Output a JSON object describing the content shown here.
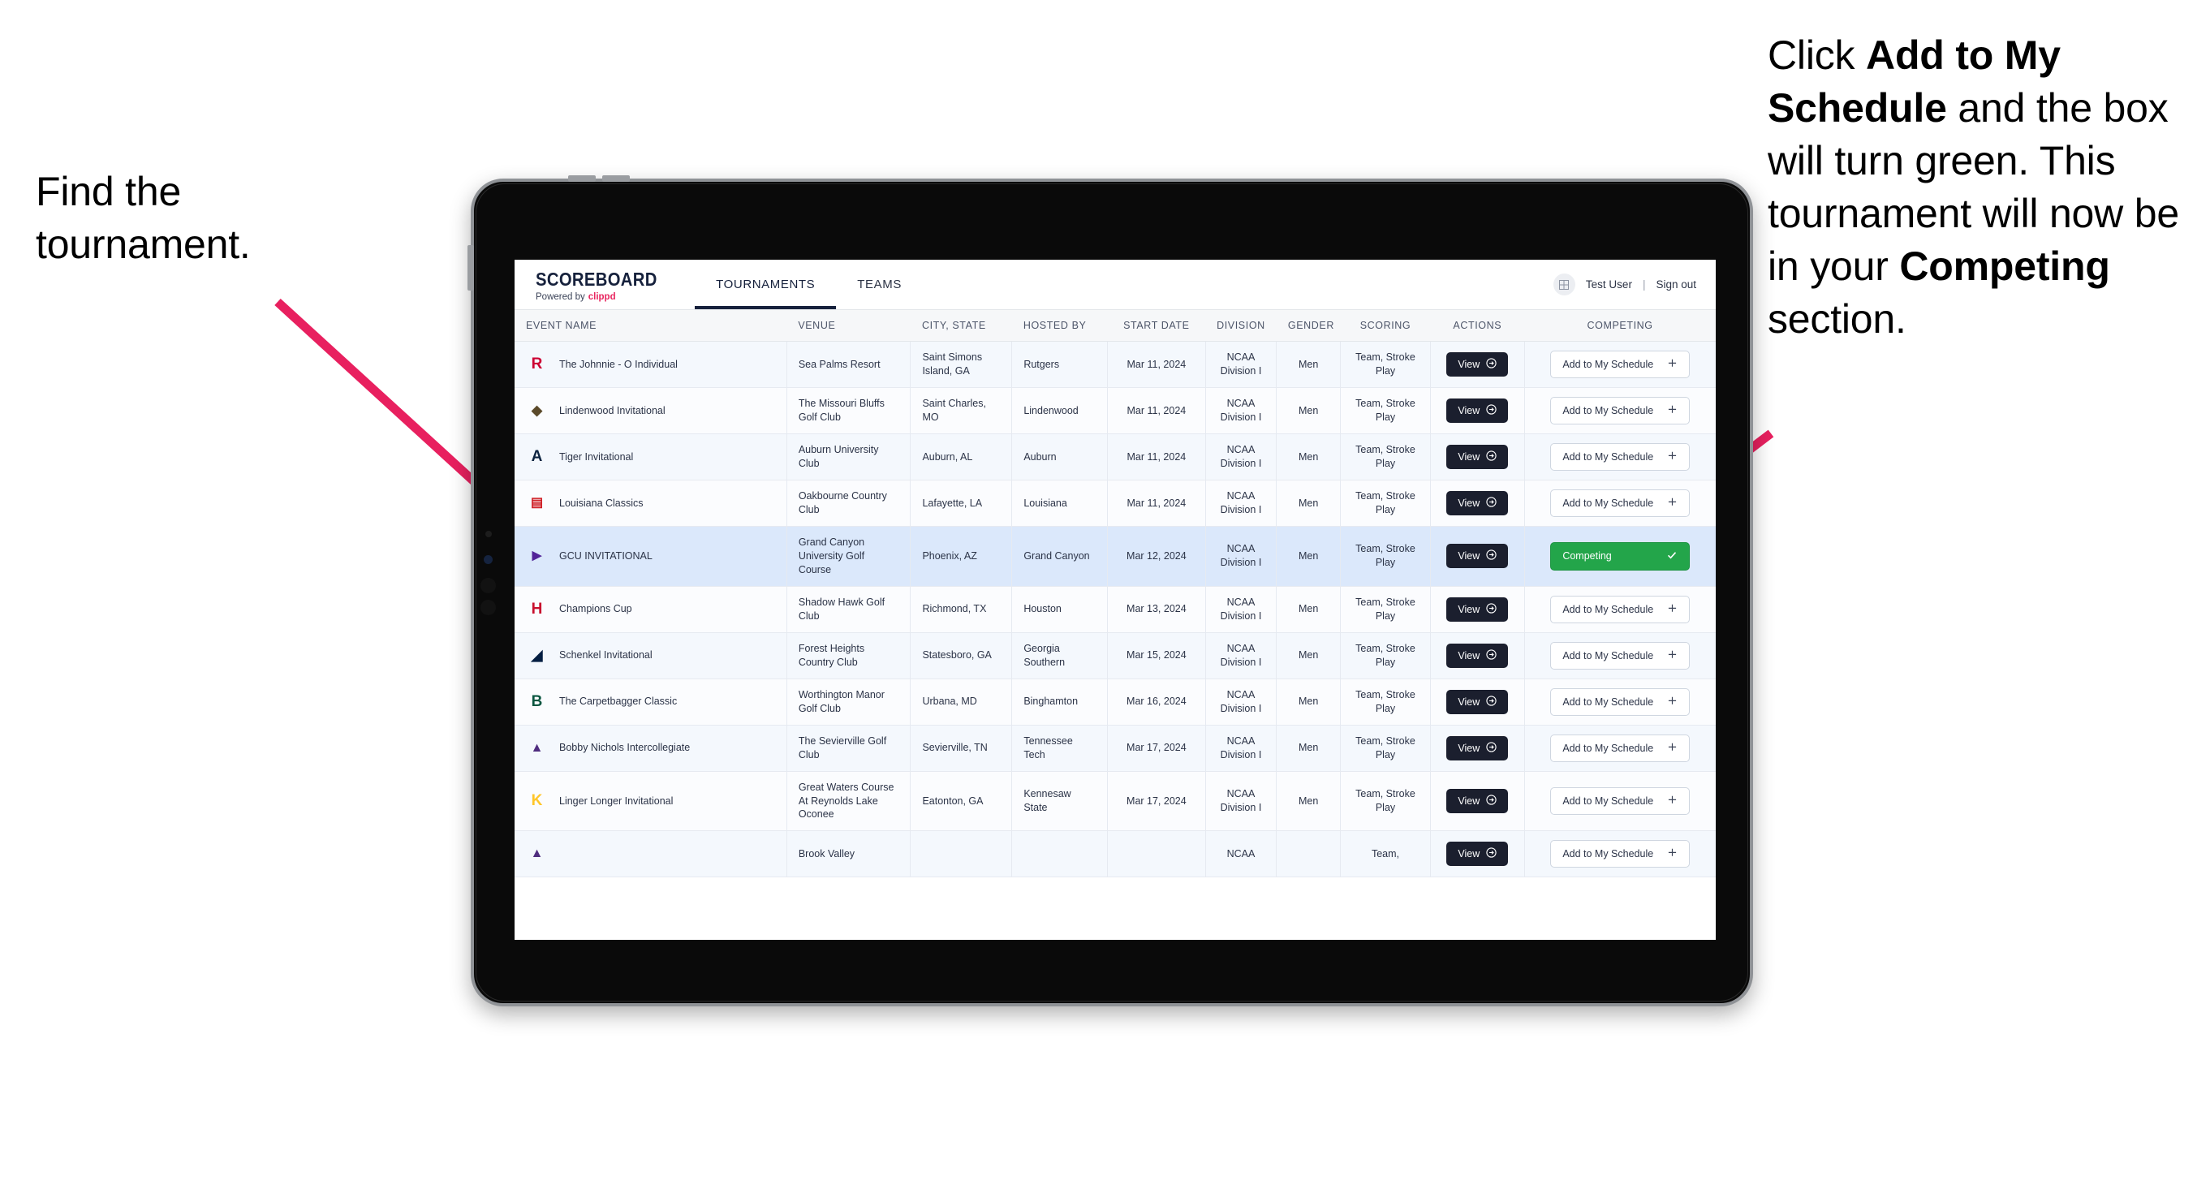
{
  "annotations": {
    "left": {
      "line1": "Find the",
      "line2": "tournament."
    },
    "right": {
      "seg1": "Click ",
      "bold1": "Add to My Schedule",
      "seg2": " and the box will turn green. This tournament will now be in your ",
      "bold2": "Competing",
      "seg3": " section."
    },
    "arrow_color": "#e8205f"
  },
  "app": {
    "brand": {
      "title": "SCOREBOARD",
      "powered_by": "Powered by",
      "vendor": "clippd",
      "vendor_color": "#e8255f"
    },
    "nav": [
      {
        "label": "TOURNAMENTS",
        "active": true
      },
      {
        "label": "TEAMS",
        "active": false
      }
    ],
    "user": {
      "avatar_icon": "grid-icon",
      "name": "Test User",
      "separator": "|",
      "sign_out": "Sign out"
    },
    "table": {
      "columns": [
        "EVENT NAME",
        "VENUE",
        "CITY, STATE",
        "HOSTED BY",
        "START DATE",
        "DIVISION",
        "GENDER",
        "SCORING",
        "ACTIONS",
        "COMPETING"
      ],
      "view_label": "View",
      "add_label": "Add to My Schedule",
      "add_icon": "plus-icon",
      "competing_label": "Competing",
      "competing_icon": "check-icon",
      "competing_color": "#23a54a",
      "rows": [
        {
          "event": "The Johnnie - O Individual",
          "logo": "rutgers-r-logo",
          "venue": "Sea Palms Resort",
          "city": "Saint Simons Island, GA",
          "host": "Rutgers",
          "date": "Mar 11, 2024",
          "division": "NCAA Division I",
          "gender": "Men",
          "scoring": "Team, Stroke Play",
          "competing": false
        },
        {
          "event": "Lindenwood Invitational",
          "logo": "lindenwood-lion-logo",
          "venue": "The Missouri Bluffs Golf Club",
          "city": "Saint Charles, MO",
          "host": "Lindenwood",
          "date": "Mar 11, 2024",
          "division": "NCAA Division I",
          "gender": "Men",
          "scoring": "Team, Stroke Play",
          "competing": false
        },
        {
          "event": "Tiger Invitational",
          "logo": "auburn-au-logo",
          "venue": "Auburn University Club",
          "city": "Auburn, AL",
          "host": "Auburn",
          "date": "Mar 11, 2024",
          "division": "NCAA Division I",
          "gender": "Men",
          "scoring": "Team, Stroke Play",
          "competing": false
        },
        {
          "event": "Louisiana Classics",
          "logo": "ragin-cajuns-logo",
          "venue": "Oakbourne Country Club",
          "city": "Lafayette, LA",
          "host": "Louisiana",
          "date": "Mar 11, 2024",
          "division": "NCAA Division I",
          "gender": "Men",
          "scoring": "Team, Stroke Play",
          "competing": false
        },
        {
          "event": "GCU INVITATIONAL",
          "logo": "grand-canyon-lope-logo",
          "venue": "Grand Canyon University Golf Course",
          "city": "Phoenix, AZ",
          "host": "Grand Canyon",
          "date": "Mar 12, 2024",
          "division": "NCAA Division I",
          "gender": "Men",
          "scoring": "Team, Stroke Play",
          "competing": true
        },
        {
          "event": "Champions Cup",
          "logo": "houston-uh-logo",
          "venue": "Shadow Hawk Golf Club",
          "city": "Richmond, TX",
          "host": "Houston",
          "date": "Mar 13, 2024",
          "division": "NCAA Division I",
          "gender": "Men",
          "scoring": "Team, Stroke Play",
          "competing": false
        },
        {
          "event": "Schenkel Invitational",
          "logo": "georgia-southern-eagle-logo",
          "venue": "Forest Heights Country Club",
          "city": "Statesboro, GA",
          "host": "Georgia Southern",
          "date": "Mar 15, 2024",
          "division": "NCAA Division I",
          "gender": "Men",
          "scoring": "Team, Stroke Play",
          "competing": false
        },
        {
          "event": "The Carpetbagger Classic",
          "logo": "binghamton-b-logo",
          "venue": "Worthington Manor Golf Club",
          "city": "Urbana, MD",
          "host": "Binghamton",
          "date": "Mar 16, 2024",
          "division": "NCAA Division I",
          "gender": "Men",
          "scoring": "Team, Stroke Play",
          "competing": false
        },
        {
          "event": "Bobby Nichols Intercollegiate",
          "logo": "tennessee-tech-eagle-logo",
          "venue": "The Sevierville Golf Club",
          "city": "Sevierville, TN",
          "host": "Tennessee Tech",
          "date": "Mar 17, 2024",
          "division": "NCAA Division I",
          "gender": "Men",
          "scoring": "Team, Stroke Play",
          "competing": false
        },
        {
          "event": "Linger Longer Invitational",
          "logo": "kennesaw-state-ks-logo",
          "venue": "Great Waters Course At Reynolds Lake Oconee",
          "city": "Eatonton, GA",
          "host": "Kennesaw State",
          "date": "Mar 17, 2024",
          "division": "NCAA Division I",
          "gender": "Men",
          "scoring": "Team, Stroke Play",
          "competing": false
        },
        {
          "event": "",
          "logo": "partial-logo",
          "venue": "Brook Valley",
          "city": "",
          "host": "",
          "date": "",
          "division": "NCAA",
          "gender": "",
          "scoring": "Team,",
          "competing": false
        }
      ]
    }
  }
}
